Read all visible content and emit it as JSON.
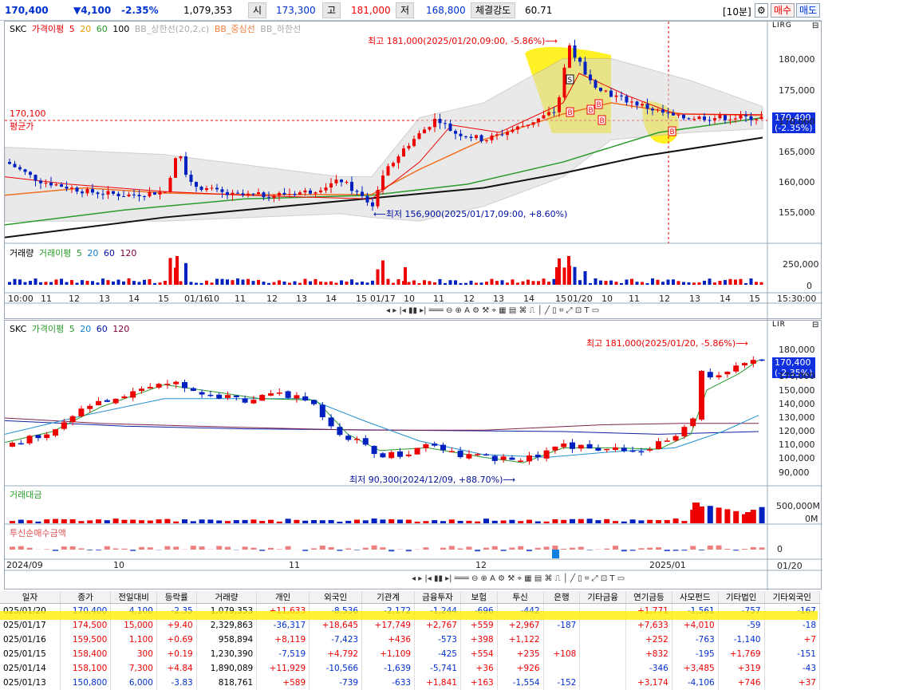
{
  "topbar": {
    "price": "170,400",
    "change": "▼4,100",
    "pct": "-2.35%",
    "volume": "1,079,353",
    "open_label": "시",
    "open": "173,300",
    "high_label": "고",
    "high": "181,000",
    "low_label": "저",
    "low": "168,800",
    "strength_label": "체결강도",
    "strength": "60.71",
    "interval": "[10분]",
    "buy": "매수",
    "sell": "매도"
  },
  "panel1": {
    "legend": {
      "name": "SKC",
      "ma": "가격이평",
      "p5": "5",
      "p20": "20",
      "p60": "60",
      "p100": "100",
      "bbu": "BB_상한선(20,2,c)",
      "bbm": "BB_중심선",
      "bbl": "BB_하한선"
    },
    "annot_high": "최고 181,000(2025/01/20,09:00, -5.86%)⟶",
    "annot_low": "⟵최저 156,900(2025/01/17,09:00, +8.60%)",
    "avg_val": "170,100",
    "avg_label": "평균가",
    "price_box": "170,400",
    "price_box_pct": "(-2.35%)",
    "yticks": [
      "180,000",
      "175,000",
      "170,000",
      "165,000",
      "160,000",
      "155,000"
    ],
    "vol_legend": {
      "v": "거래량",
      "ma": "거래이평",
      "p5": "5",
      "p20": "20",
      "p60": "60",
      "p120": "120"
    },
    "vol_ticks": [
      "250,000",
      "0"
    ],
    "xticks": [
      "10:00",
      "11",
      "12",
      "13",
      "14",
      "15",
      "01/16",
      "10",
      "11",
      "12",
      "13",
      "14",
      "15",
      "01/17",
      "10",
      "11",
      "12",
      "13",
      "14",
      "15",
      "01/20",
      "10",
      "11",
      "12",
      "13",
      "14",
      "15"
    ],
    "xtime": "15:30:00",
    "markers": [
      "S",
      "B",
      "B",
      "B",
      "B",
      "B"
    ],
    "corner": "LIRG"
  },
  "panel2": {
    "legend": {
      "name": "SKC",
      "ma": "가격이평",
      "p5": "5",
      "p20": "20",
      "p60": "60",
      "p120": "120"
    },
    "annot_high": "최고 181,000(2025/01/20, -5.86%)⟶",
    "annot_low": "최저 90,300(2024/12/09, +88.70%)⟶",
    "price_box": "170,400",
    "price_box_pct": "(-2.35%)",
    "yticks": [
      "180,000",
      "170,000",
      "150,000",
      "140,000",
      "130,000",
      "120,000",
      "110,000",
      "100,000",
      "90,000"
    ],
    "amt_label": "거래대금",
    "amt_ticks": [
      "500,000M",
      "0M"
    ],
    "inst_label": "투신순매수금액",
    "inst_tick": "0",
    "xticks": [
      "2024/09",
      "10",
      "11",
      "12",
      "2025/01"
    ],
    "xdate": "01/20",
    "corner": "LIR"
  },
  "table": {
    "headers": [
      "일자",
      "종가",
      "전일대비",
      "등락률",
      "거래량",
      "개인",
      "외국인",
      "기관계",
      "금융투자",
      "보험",
      "투신",
      "은행",
      "기타금융",
      "연기금등",
      "사모펀드",
      "기타법인",
      "기타외국인"
    ],
    "rows": [
      [
        "025/01/20",
        "170,400",
        "4,100",
        "-2.35",
        "1,079,353",
        "+11,633",
        "-8,536",
        "-2,172",
        "-1,244",
        "-696",
        "-442",
        "",
        "",
        "+1,771",
        "-1,561",
        "-757",
        "-167"
      ],
      [
        "025/01/17",
        "174,500",
        "15,000",
        "+9.40",
        "2,329,863",
        "-36,317",
        "+18,645",
        "+17,749",
        "+2,767",
        "+559",
        "+2,967",
        "-187",
        "",
        "+7,633",
        "+4,010",
        "-59",
        "-18"
      ],
      [
        "025/01/16",
        "159,500",
        "1,100",
        "+0.69",
        "958,894",
        "+8,119",
        "-7,423",
        "+436",
        "-573",
        "+398",
        "+1,122",
        "",
        "",
        "+252",
        "-763",
        "-1,140",
        "+7"
      ],
      [
        "025/01/15",
        "158,400",
        "300",
        "+0.19",
        "1,230,390",
        "-7,519",
        "+4,792",
        "+1,109",
        "-425",
        "+554",
        "+235",
        "+108",
        "",
        "+832",
        "-195",
        "+1,769",
        "-151"
      ],
      [
        "025/01/14",
        "158,100",
        "7,300",
        "+4.84",
        "1,890,089",
        "+11,929",
        "-10,566",
        "-1,639",
        "-5,741",
        "+36",
        "+926",
        "",
        "",
        "-346",
        "+3,485",
        "+319",
        "-43"
      ],
      [
        "025/01/13",
        "150,800",
        "6,000",
        "-3.83",
        "818,761",
        "+589",
        "-739",
        "-633",
        "+1,841",
        "+163",
        "-1,554",
        "-152",
        "",
        "+3,174",
        "-4,106",
        "+746",
        "+37"
      ]
    ]
  },
  "chart_data": [
    {
      "type": "candlestick",
      "title": "SKC 10분",
      "ylim": [
        153000,
        183000
      ],
      "high": 181000,
      "low": 156900,
      "last": 170400
    },
    {
      "type": "candlestick",
      "title": "SKC 일",
      "ylim": [
        85000,
        185000
      ],
      "high": 181000,
      "low": 90300,
      "last": 170400
    }
  ]
}
